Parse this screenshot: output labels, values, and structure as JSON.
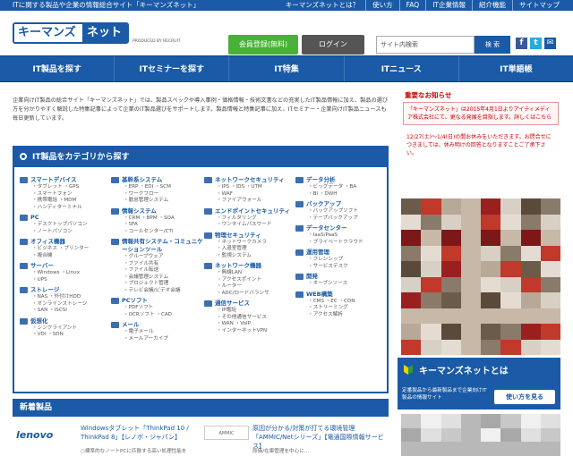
{
  "topbar": {
    "tagline": "ITに関する製品や企業の情報総合サイト「キーマンズネット」",
    "links": [
      "キーマンズネットとは？",
      "使い方",
      "FAQ",
      "IT企業情報",
      "紹介機能",
      "サイトマップ"
    ]
  },
  "header": {
    "logo_left": "キーマンズ",
    "logo_right": "ネット",
    "produced": "PRODUCED BY RECRUIT",
    "register": "会員登録(無料)",
    "login": "ログイン",
    "search_placeholder": "サイト内検索",
    "search_button": "検 索",
    "sns": [
      "f",
      "t",
      "✉"
    ]
  },
  "nav": [
    "IT製品を探す",
    "ITセミナーを探す",
    "IT特集",
    "ITニュース",
    "IT単語帳"
  ],
  "intro": "企業向けIT製品の総合サイト「キーマンズネット」では、製品スペックや導入事例・価格情報・技術文書などの充実したIT製品情報に加え、製品の選び方を分かりやすく解説した特集記事によって企業のIT製品選びをサポートします。製品情報と特集記事に加え、ITセミナー・企業向けIT製品ニュースも毎日更新しています。",
  "category": {
    "title": "IT製品をカテゴリから探す",
    "columns": [
      [
        {
          "h": "スマートデバイス",
          "items": [
            "・タブレット ・GPS",
            "・スマートフォン",
            "・携帯電話 ・MDM",
            "・ハンディターミナル"
          ]
        },
        {
          "h": "PC",
          "items": [
            "・デスクトップパソコン",
            "・ノートパソコン"
          ]
        },
        {
          "h": "オフィス機器",
          "items": [
            "・ビジネス ・プリンター",
            "・複合機"
          ]
        },
        {
          "h": "サーバー",
          "items": [
            "・Windows ・Linux",
            "・UPS"
          ]
        },
        {
          "h": "ストレージ",
          "items": [
            "・NAS ・外付けHDD",
            "・オンラインストレージ",
            "・SAN ・iSCSI"
          ]
        },
        {
          "h": "仮想化",
          "items": [
            "・シンクライアント",
            "・VDI ・SDN"
          ]
        }
      ],
      [
        {
          "h": "基幹系システム",
          "items": [
            "・ERP ・EDI ・SCM",
            "・ワークフロー",
            "・勤怠管理システム"
          ]
        },
        {
          "h": "情報システム",
          "items": [
            "・CRM ・BPM ・SOA",
            "・SFA",
            "・コールセンター/CTI"
          ]
        },
        {
          "h": "情報共有システム・コミュニケーションツール",
          "items": [
            "・グループウェア",
            "・ファイル共有",
            "・ファイル転送",
            "・会議管理システム",
            "・プロジェクト管理",
            "・テレビ会議/ビデオ会議"
          ]
        },
        {
          "h": "PCソフト",
          "items": [
            "・PDFソフト",
            "・OCRソフト ・CAD"
          ]
        },
        {
          "h": "メール",
          "items": [
            "・電子メール",
            "・メールアーカイブ"
          ]
        }
      ],
      [
        {
          "h": "ネットワークセキュリティ",
          "items": [
            "・IPS ・IDS ・UTM",
            "・WAF",
            "・ファイアウォール"
          ]
        },
        {
          "h": "エンドポイントセキュリティ",
          "items": [
            "・フィルタリング",
            "・ワンタイムパスワード"
          ]
        },
        {
          "h": "物理セキュリティ",
          "items": [
            "・ネットワークカメラ",
            "・入退室管理",
            "・監視システム"
          ]
        },
        {
          "h": "ネットワーク機器",
          "items": [
            "・無線LAN",
            "・アクセスポイント",
            "・ルーター",
            "・ADC/ロードバランサ"
          ]
        },
        {
          "h": "通信サービス",
          "items": [
            "・IP電話",
            "・その他通信サービス",
            "・WAN ・VoIP",
            "・インターネットVPN"
          ]
        }
      ],
      [
        {
          "h": "データ分析",
          "items": [
            "・ビッグデータ ・BA",
            "・BI ・DWH"
          ]
        },
        {
          "h": "バックアップ",
          "items": [
            "・バックアップソフト",
            "・テープバックアップ"
          ]
        },
        {
          "h": "データセンター",
          "items": [
            "・IaaS/PaaS",
            "・プライベートクラウド"
          ]
        },
        {
          "h": "運用管理",
          "items": [
            "・フレンシップ",
            "・サービスデスク"
          ]
        },
        {
          "h": "開発",
          "items": [
            "・オープンソース"
          ]
        },
        {
          "h": "WEB構築",
          "items": [
            "・CMS ・EC ・CDN",
            "・ストリーミング",
            "・アクセス解析"
          ]
        }
      ]
    ]
  },
  "news": {
    "title": "新着製品",
    "items": [
      {
        "brand": "lenovo",
        "title": "Windowsタブレット「ThinkPad 10 / ThinkPad 8」【レノボ・ジャパン】",
        "body": "○標準的なノートPCに匹敵する高い処理性能を"
      },
      {
        "brand": "AMMIC",
        "title": "原因が分かる/対策が打てる環境管理「AMMIC/Netシリーズ」【電通国際情報サービス】",
        "body": "原価/在庫管理を中心に..."
      }
    ]
  },
  "notice": {
    "title": "重要なお知らせ",
    "text1": "「キーマンズネット」は2015年4月1日よりアイティメディア株式会社にて、更なる発展を目指します。詳しくはこちら",
    "text2": "12/27(土)〜1/4(日)の間お休みをいただきます。お問合せにつきましては、休み明けの回答となりますことご了承下さい。"
  },
  "about": {
    "title": "キーマンズネットとは",
    "desc": "定番製品から最新製品まで企業向けIT製品の情報サイト",
    "button": "使い方を見る"
  }
}
